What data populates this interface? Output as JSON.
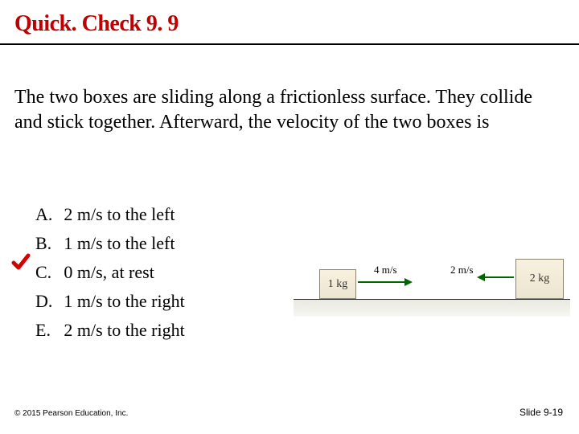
{
  "title": "Quick. Check 9. 9",
  "question": "The two boxes are sliding along a frictionless surface. They collide and stick together. Afterward, the velocity of the two boxes is",
  "answers": [
    {
      "letter": "A.",
      "text": "2 m/s to the left"
    },
    {
      "letter": "B.",
      "text": "1 m/s to the left"
    },
    {
      "letter": "C.",
      "text": "0 m/s, at rest"
    },
    {
      "letter": "D.",
      "text": "1 m/s to the right"
    },
    {
      "letter": "E.",
      "text": "2 m/s to the right"
    }
  ],
  "correct_index": 2,
  "figure": {
    "box1_label": "1 kg",
    "box2_label": "2 kg",
    "v1_label": "4 m/s",
    "v2_label": "2 m/s"
  },
  "copyright": "© 2015 Pearson Education, Inc.",
  "slide_number": "Slide 9-19"
}
